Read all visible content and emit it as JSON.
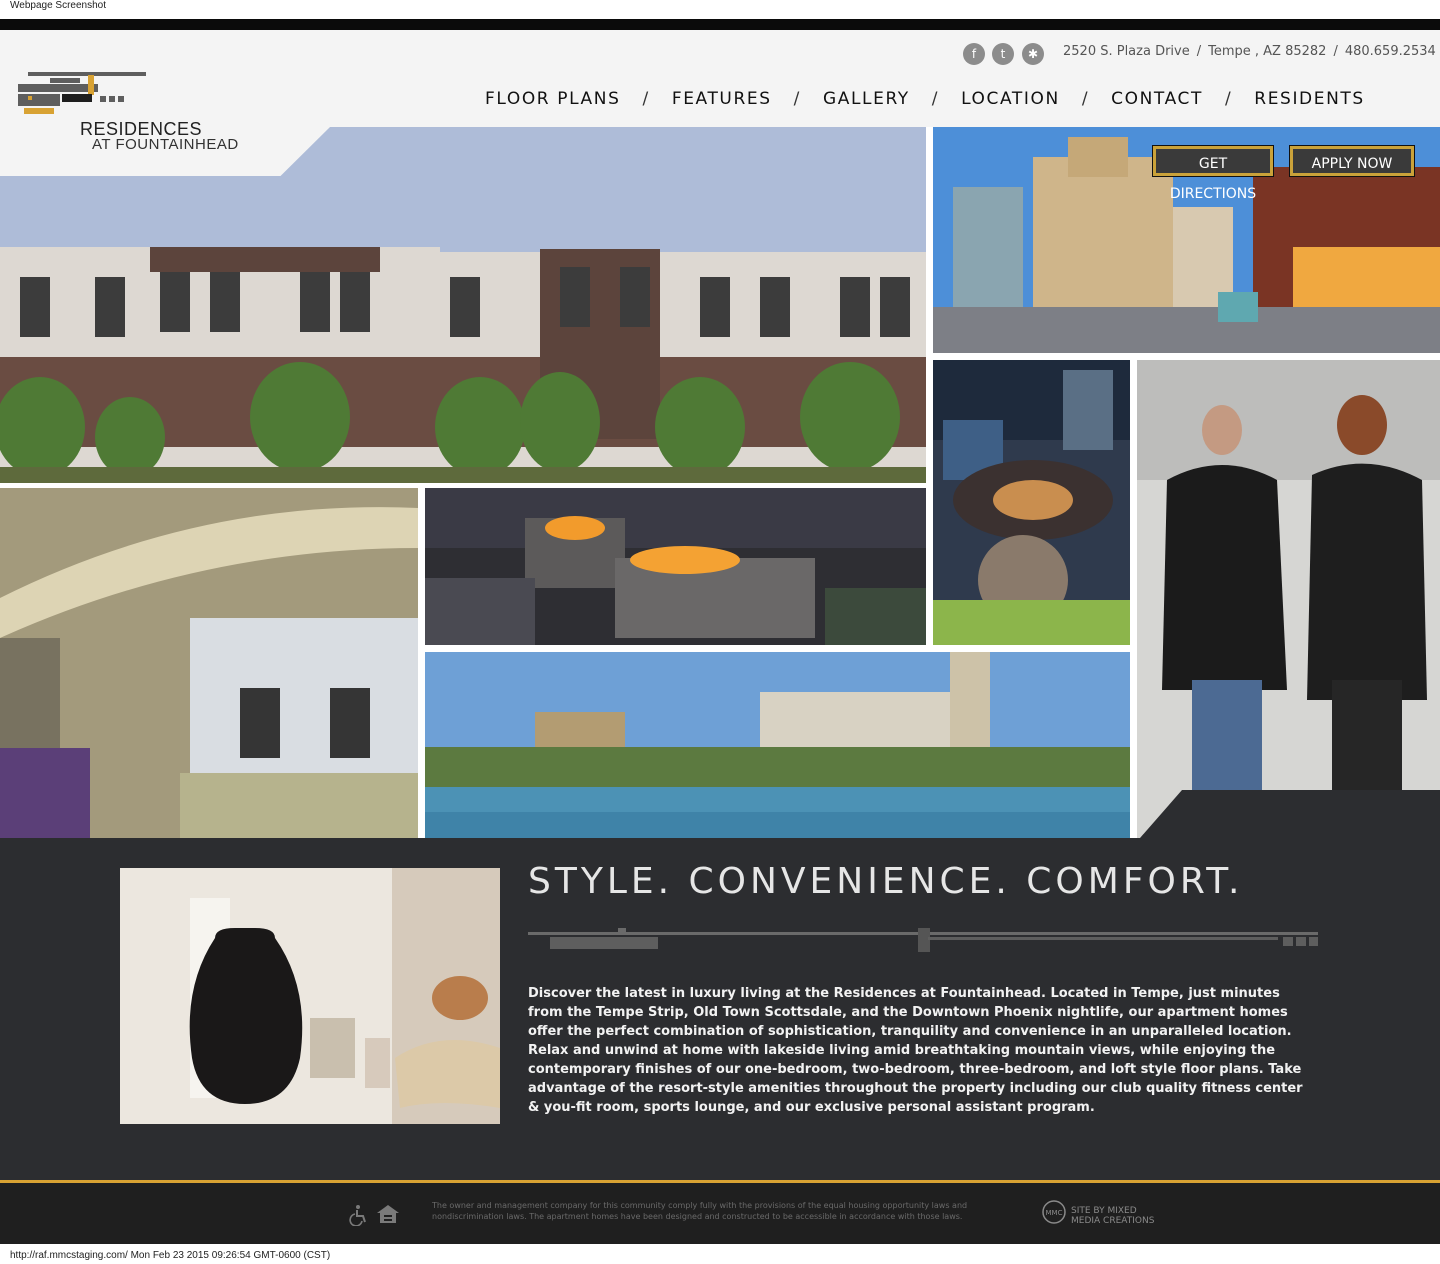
{
  "screenshot": {
    "caption": "Webpage Screenshot",
    "status_line": "http://raf.mmcstaging.com/ Mon Feb 23 2015 09:26:54 GMT-0600 (CST)"
  },
  "brand": {
    "line1": "RESIDENCES",
    "line2": "AT FOUNTAINHEAD",
    "colors": {
      "accent": "#d8a233",
      "dark": "#2c2d30",
      "gray": "#5e5e5e"
    }
  },
  "social": [
    {
      "name": "facebook",
      "glyph": "f"
    },
    {
      "name": "twitter",
      "glyph": "t"
    },
    {
      "name": "yelp",
      "glyph": "✱"
    }
  ],
  "contact": {
    "street": "2520 S. Plaza Drive",
    "city": "Tempe , AZ 85282",
    "phone": "480.659.2534",
    "separator": "/"
  },
  "nav": {
    "separator": "/",
    "items": [
      "FLOOR PLANS",
      "FEATURES",
      "GALLERY",
      "LOCATION",
      "CONTACT",
      "RESIDENTS"
    ]
  },
  "cta": {
    "directions": "GET DIRECTIONS",
    "apply": "APPLY NOW"
  },
  "intro": {
    "headline": "STYLE. CONVENIENCE. COMFORT.",
    "body": "Discover the latest in luxury living at the Residences at Fountainhead. Located in Tempe, just minutes from the Tempe Strip, Old Town Scottsdale, and the Downtown Phoenix nightlife, our apartment homes offer the perfect combination of sophistication, tranquility and convenience in an unparalleled location.  Relax and unwind at home with lakeside living amid breathtaking mountain views, while enjoying the contemporary finishes of our one-bedroom, two-bedroom, three-bedroom, and loft style floor plans. Take advantage of the resort-style amenities throughout the property including our club quality fitness center & you-fit room, sports lounge, and our exclusive personal assistant program."
  },
  "footer": {
    "legal": "The owner and management company for this community comply fully with the provisions of the equal housing opportunity laws and nondiscrimination laws. The apartment homes have been designed and constructed to be accessible in accordance with those laws.",
    "credit_line1": "SITE BY MIXED",
    "credit_line2": "MEDIA CREATIONS",
    "credit_logo": "MMC"
  }
}
